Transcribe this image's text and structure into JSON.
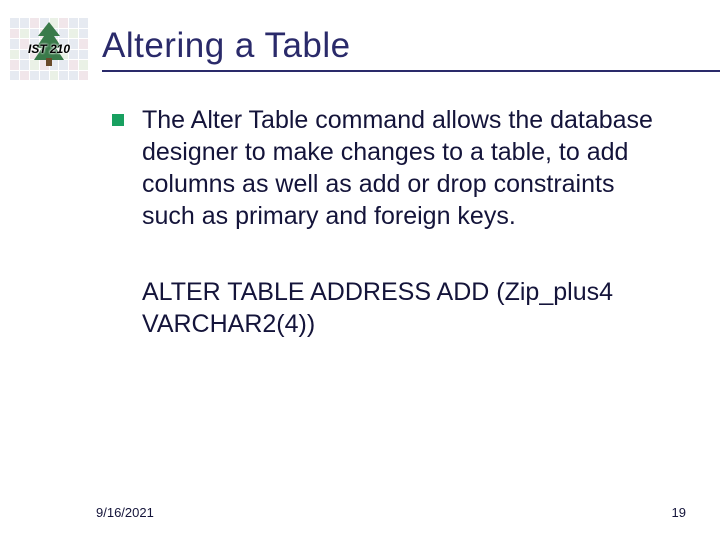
{
  "header": {
    "logo_label": "IST 210",
    "title": "Altering a Table"
  },
  "body": {
    "bullet_text": "The Alter Table command allows the database designer to make changes to a table, to add columns as well as add or drop constraints such as primary and foreign keys.",
    "code_text": "ALTER TABLE ADDRESS ADD (Zip_plus4 VARCHAR2(4))"
  },
  "footer": {
    "date": "9/16/2021",
    "page": "19"
  }
}
